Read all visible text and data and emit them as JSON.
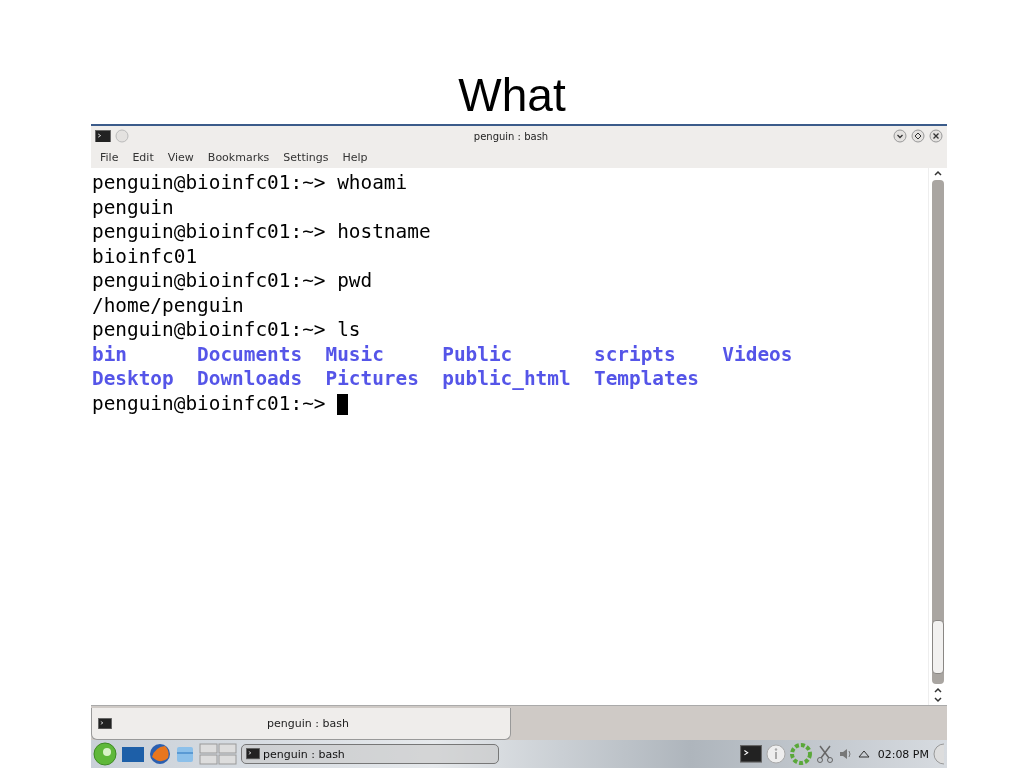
{
  "slide": {
    "title": "What"
  },
  "window": {
    "title": "penguin : bash"
  },
  "menu": [
    "File",
    "Edit",
    "View",
    "Bookmarks",
    "Settings",
    "Help"
  ],
  "terminal": {
    "lines": [
      {
        "kind": "prompt",
        "prompt": "penguin@bioinfc01:~>",
        "command": "whoami"
      },
      {
        "kind": "output",
        "text": "penguin"
      },
      {
        "kind": "prompt",
        "prompt": "penguin@bioinfc01:~>",
        "command": "hostname"
      },
      {
        "kind": "output",
        "text": "bioinfc01"
      },
      {
        "kind": "prompt",
        "prompt": "penguin@bioinfc01:~>",
        "command": "pwd"
      },
      {
        "kind": "output",
        "text": "/home/penguin"
      },
      {
        "kind": "prompt",
        "prompt": "penguin@bioinfc01:~>",
        "command": "ls"
      },
      {
        "kind": "listing",
        "rows": [
          [
            "bin",
            "Documents",
            "Music",
            "Public",
            "scripts",
            "Videos"
          ],
          [
            "Desktop",
            "Downloads",
            "Pictures",
            "public_html",
            "Templates"
          ]
        ]
      },
      {
        "kind": "prompt",
        "prompt": "penguin@bioinfc01:~>",
        "cursor": true
      }
    ]
  },
  "tabs": [
    {
      "label": "penguin : bash",
      "selected": true
    }
  ],
  "taskbar": {
    "tasks": [
      {
        "label": "penguin : bash"
      }
    ],
    "clock": "02:08 PM"
  }
}
